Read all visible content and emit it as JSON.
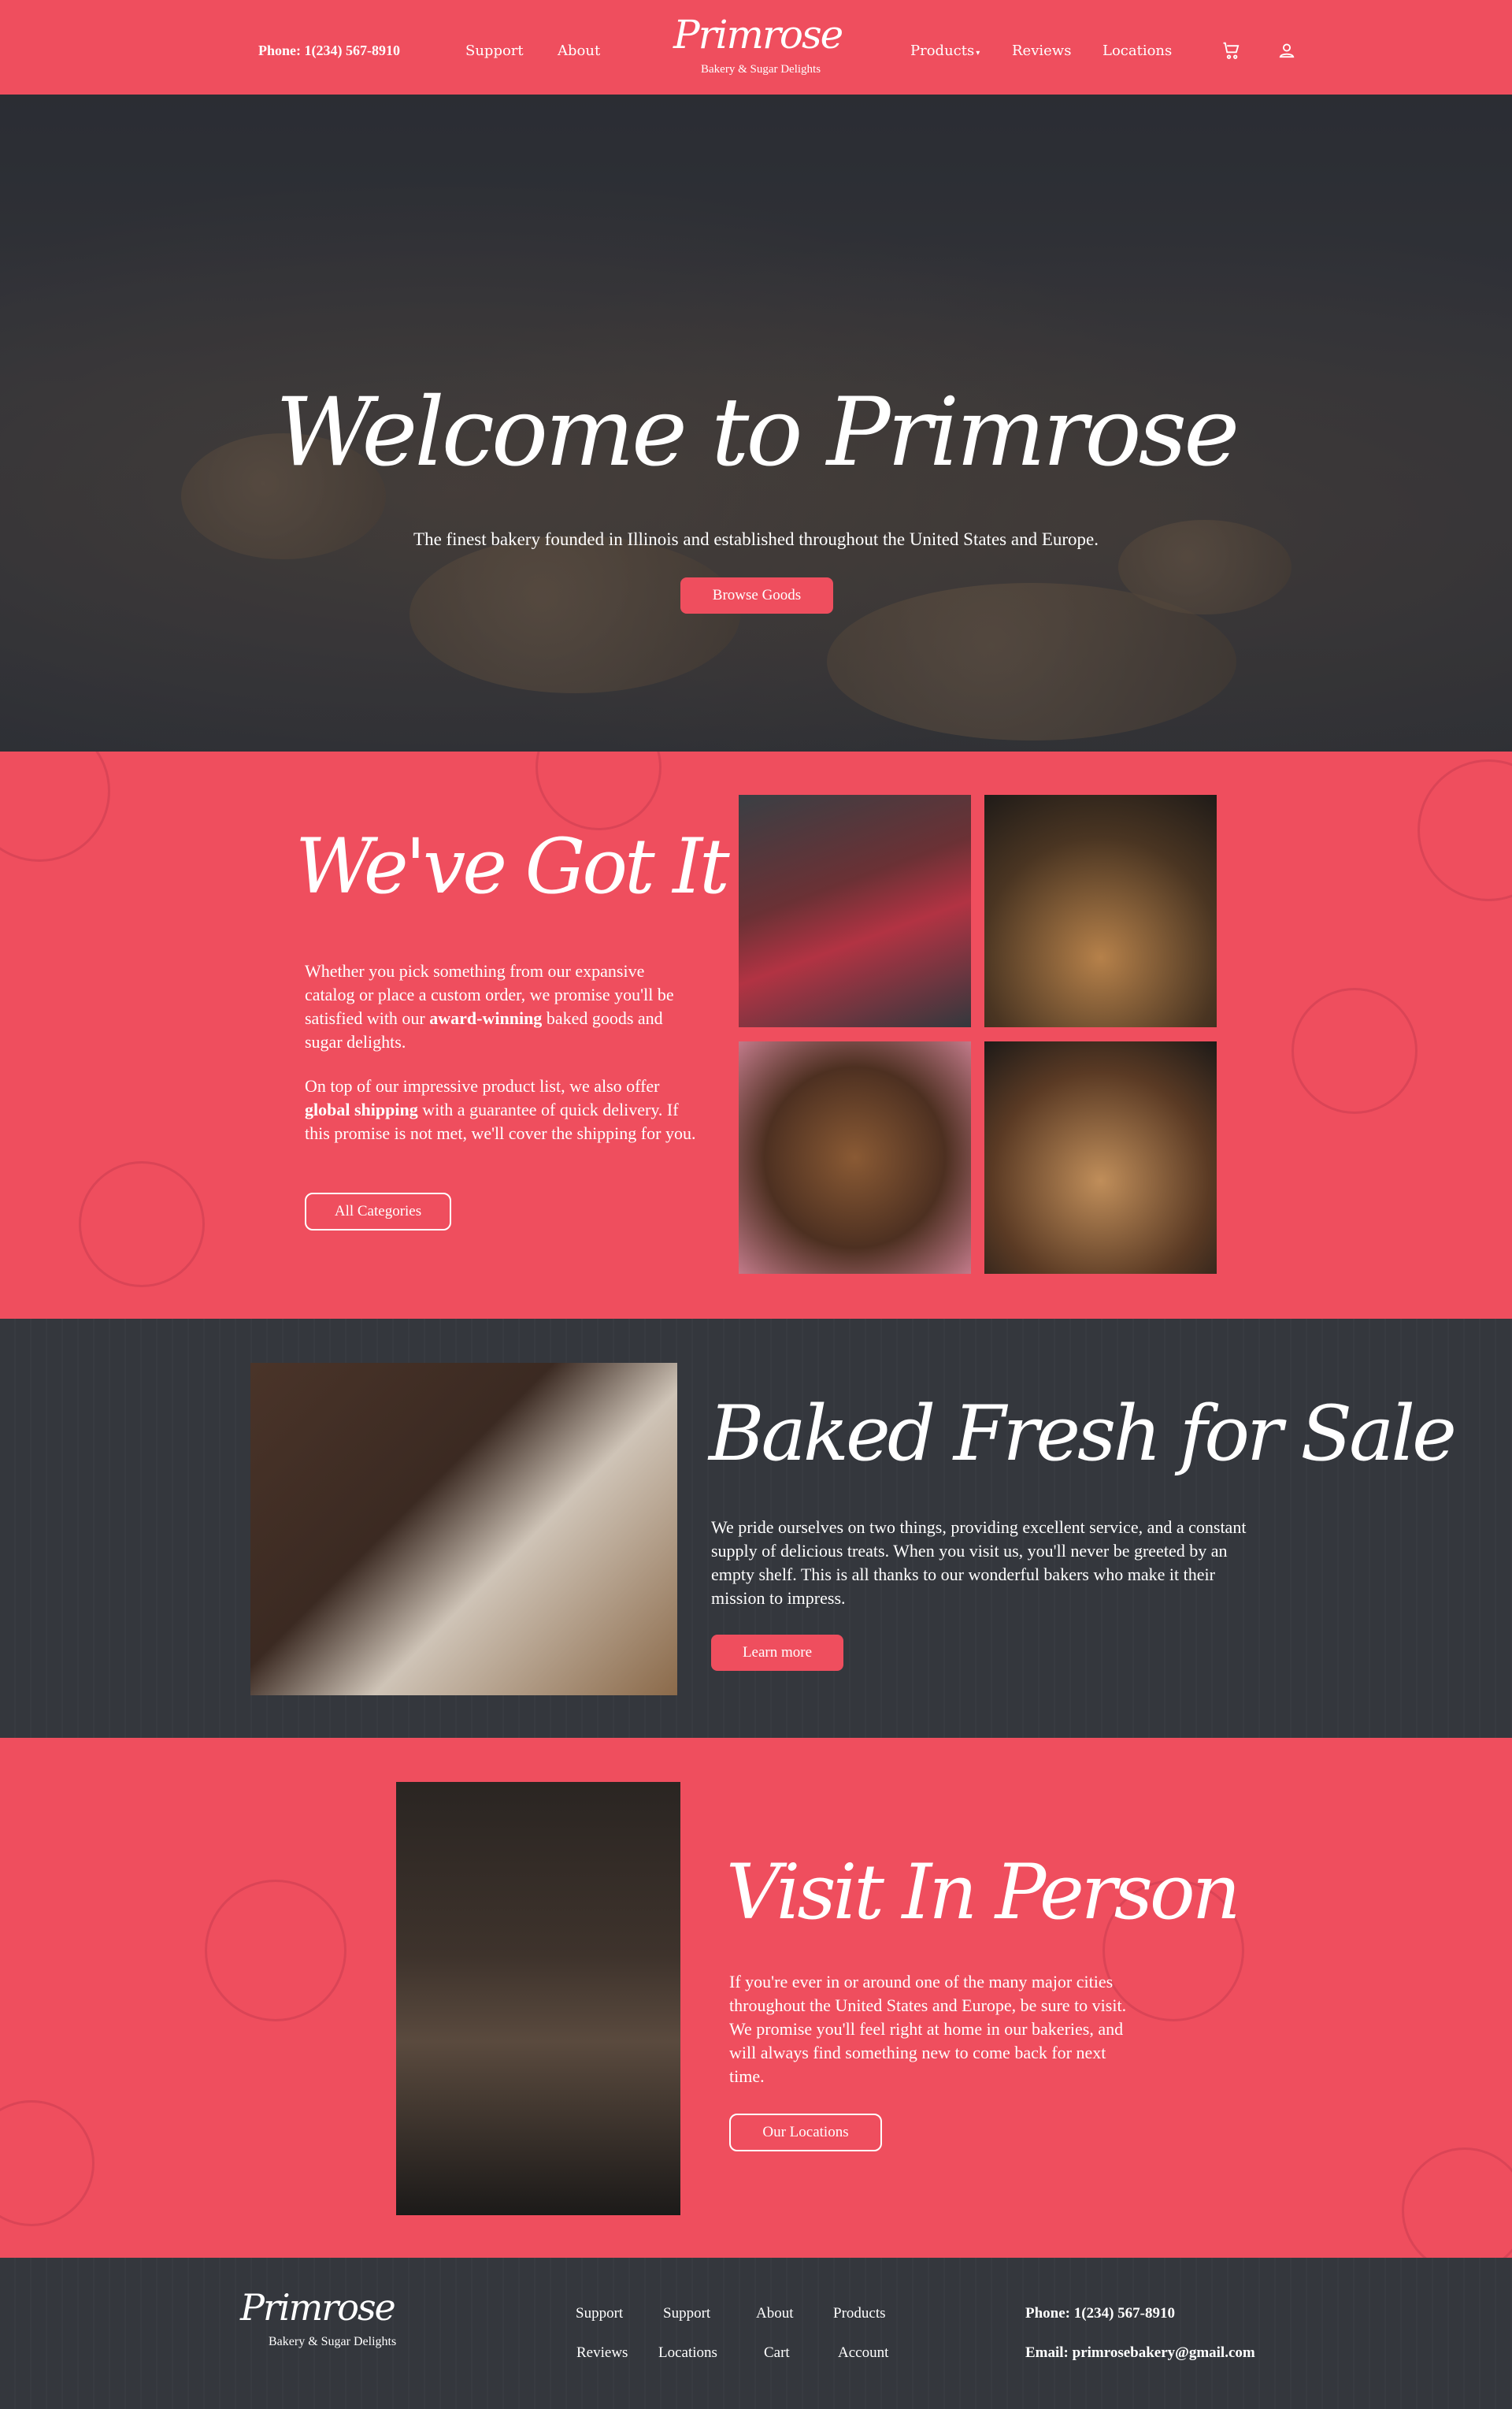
{
  "nav": {
    "phone": "Phone: 1(234) 567-8910",
    "support": "Support",
    "about": "About",
    "logo_word": "Primrose",
    "logo_sub": "Bakery & Sugar Delights",
    "products": "Products",
    "reviews": "Reviews",
    "locations": "Locations",
    "cart_icon": "cart-icon",
    "user_icon": "user-icon"
  },
  "hero": {
    "title": "Welcome to Primrose",
    "subtitle": "The finest bakery founded in Illinois and established throughout the United States and Europe.",
    "cta": "Browse Goods"
  },
  "section_all": {
    "title": "We've Got It All",
    "para1_a": "Whether you pick something from our expansive catalog or place a custom order, we promise you'll be satisfied with our ",
    "para1_b": "award-winning",
    "para1_c": " baked goods and sugar delights.",
    "para2_a": "On top of our impressive product list, we also offer ",
    "para2_b": "global shipping",
    "para2_c": " with a guarantee of quick delivery. If this promise is not met, we'll cover the shipping for you.",
    "cta": "All Categories"
  },
  "section_fresh": {
    "title": "Baked Fresh for Sale",
    "para": "We pride ourselves on two things, providing excellent service, and a constant supply of delicious treats. When you visit us, you'll never be greeted by an empty shelf. This is all thanks to our wonderful bakers who make it their mission to impress.",
    "cta": "Learn more"
  },
  "section_visit": {
    "title": "Visit In Person",
    "para": "If you're ever in or around one of the many major cities throughout the United States and Europe, be sure to visit. We promise you'll feel right at home in our bakeries, and will always find something new to come back for next time.",
    "cta": "Our Locations"
  },
  "footer": {
    "logo_word": "Primrose",
    "logo_sub": "Bakery & Sugar Delights",
    "links": [
      "Support",
      "Support",
      "About",
      "Products",
      "Reviews",
      "Locations",
      "Cart",
      "Account"
    ],
    "phone": "Phone: 1(234) 567-8910",
    "email": "Email: primrosebakery@gmail.com"
  },
  "colors": {
    "brand_pink": "#ef4e5e",
    "dark": "#34373d"
  }
}
